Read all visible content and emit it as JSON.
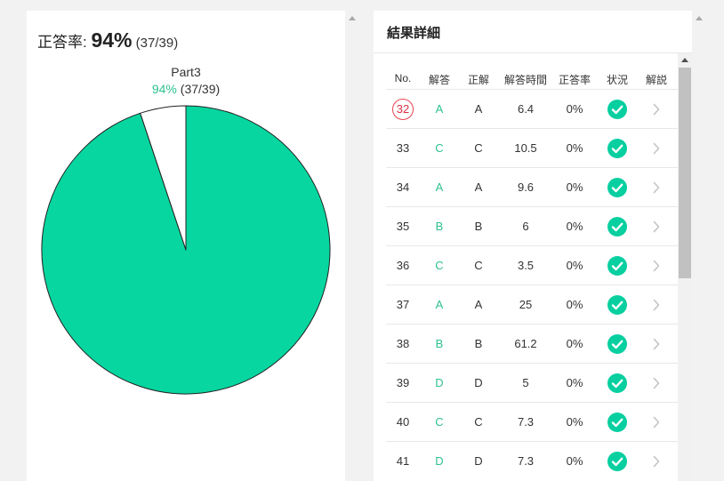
{
  "summary": {
    "rate_label": "正答率: ",
    "rate_value": "94%",
    "rate_count": " (37/39)"
  },
  "chart_data": {
    "type": "pie",
    "title": "Part3",
    "subtitle_percent": "94%",
    "subtitle_count": " (37/39)",
    "slices": [
      {
        "label": "correct",
        "value": 37,
        "color": "#07d6a0"
      },
      {
        "label": "incorrect",
        "value": 2,
        "color": "#ffffff"
      }
    ]
  },
  "results": {
    "title": "結果詳細",
    "headers": {
      "no": "No.",
      "answer": "解答",
      "correct": "正解",
      "time": "解答時間",
      "rate": "正答率",
      "status": "状況",
      "explain": "解説"
    },
    "rows": [
      {
        "no": "32",
        "answer": "A",
        "correct": "A",
        "time": "6.4",
        "rate": "0%",
        "status": "correct",
        "highlight": true
      },
      {
        "no": "33",
        "answer": "C",
        "correct": "C",
        "time": "10.5",
        "rate": "0%",
        "status": "correct"
      },
      {
        "no": "34",
        "answer": "A",
        "correct": "A",
        "time": "9.6",
        "rate": "0%",
        "status": "correct"
      },
      {
        "no": "35",
        "answer": "B",
        "correct": "B",
        "time": "6",
        "rate": "0%",
        "status": "correct"
      },
      {
        "no": "36",
        "answer": "C",
        "correct": "C",
        "time": "3.5",
        "rate": "0%",
        "status": "correct"
      },
      {
        "no": "37",
        "answer": "A",
        "correct": "A",
        "time": "25",
        "rate": "0%",
        "status": "correct"
      },
      {
        "no": "38",
        "answer": "B",
        "correct": "B",
        "time": "61.2",
        "rate": "0%",
        "status": "correct"
      },
      {
        "no": "39",
        "answer": "D",
        "correct": "D",
        "time": "5",
        "rate": "0%",
        "status": "correct"
      },
      {
        "no": "40",
        "answer": "C",
        "correct": "C",
        "time": "7.3",
        "rate": "0%",
        "status": "correct"
      },
      {
        "no": "41",
        "answer": "D",
        "correct": "D",
        "time": "7.3",
        "rate": "0%",
        "status": "correct"
      }
    ]
  },
  "icons": {
    "status": "check-circle-icon",
    "explain": "chevron-right-icon",
    "scroll_up": "caret-up-icon"
  },
  "colors": {
    "accent_green": "#07cfa0",
    "answer_text": "#2ec28e",
    "highlight_ring": "#e8434f"
  }
}
